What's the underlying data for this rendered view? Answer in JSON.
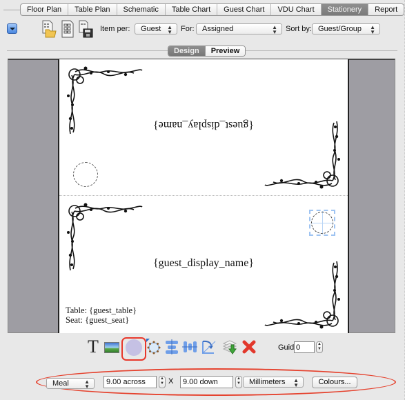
{
  "tabs": [
    {
      "label": "Floor Plan",
      "active": false
    },
    {
      "label": "Table Plan",
      "active": false
    },
    {
      "label": "Schematic",
      "active": false
    },
    {
      "label": "Table Chart",
      "active": false
    },
    {
      "label": "Guest Chart",
      "active": false
    },
    {
      "label": "VDU Chart",
      "active": false
    },
    {
      "label": "Stationery",
      "active": true
    },
    {
      "label": "Report",
      "active": false
    }
  ],
  "toolbar": {
    "menu_icon": "disclosure-triangle-icon",
    "icons": [
      "open-document-icon",
      "document-layout-icon",
      "save-document-icon"
    ],
    "item_per_label": "Item per:",
    "item_per_value": "Guest",
    "for_label": "For:",
    "for_value": "Assigned",
    "sort_by_label": "Sort by:",
    "sort_by_value": "Guest/Group"
  },
  "view_toggle": {
    "design": "Design",
    "preview": "Preview",
    "selected": "Design"
  },
  "card": {
    "top_name_upside_down": "{guest_display_name}",
    "bottom_name": "{guest_display_name}",
    "table_line": "Table: {guest_table}",
    "seat_line": "Seat: {guest_seat}"
  },
  "palette": {
    "tools": [
      "text-tool-icon",
      "image-tool-icon",
      "circle-tool-icon",
      "shape-handles-icon",
      "align-horizontal-icon",
      "align-vertical-icon",
      "rotate-flip-icon",
      "layers-down-icon",
      "delete-icon"
    ],
    "selected_tool": "circle-tool-icon",
    "guides_label": "Guides:",
    "guides_value": "0"
  },
  "bottom_bar": {
    "type_value": "Meal",
    "across_value": "9.00 across",
    "x_label": "X",
    "down_value": "9.00 down",
    "units_value": "Millimeters",
    "colours_label": "Colours..."
  },
  "colors": {
    "active_tab": "#7f7f7f",
    "highlight": "#e5432f",
    "canvas_bg": "#9e9da3",
    "selection": "#9fc4f2"
  }
}
